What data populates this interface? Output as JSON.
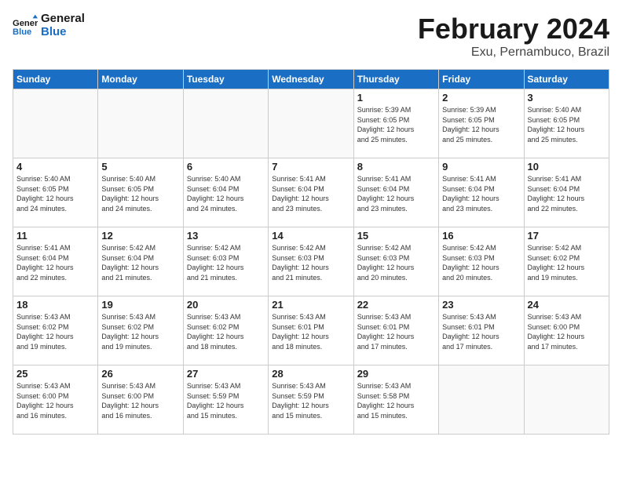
{
  "header": {
    "logo_general": "General",
    "logo_blue": "Blue",
    "month": "February 2024",
    "location": "Exu, Pernambuco, Brazil"
  },
  "weekdays": [
    "Sunday",
    "Monday",
    "Tuesday",
    "Wednesday",
    "Thursday",
    "Friday",
    "Saturday"
  ],
  "weeks": [
    [
      {
        "day": "",
        "info": ""
      },
      {
        "day": "",
        "info": ""
      },
      {
        "day": "",
        "info": ""
      },
      {
        "day": "",
        "info": ""
      },
      {
        "day": "1",
        "info": "Sunrise: 5:39 AM\nSunset: 6:05 PM\nDaylight: 12 hours\nand 25 minutes."
      },
      {
        "day": "2",
        "info": "Sunrise: 5:39 AM\nSunset: 6:05 PM\nDaylight: 12 hours\nand 25 minutes."
      },
      {
        "day": "3",
        "info": "Sunrise: 5:40 AM\nSunset: 6:05 PM\nDaylight: 12 hours\nand 25 minutes."
      }
    ],
    [
      {
        "day": "4",
        "info": "Sunrise: 5:40 AM\nSunset: 6:05 PM\nDaylight: 12 hours\nand 24 minutes."
      },
      {
        "day": "5",
        "info": "Sunrise: 5:40 AM\nSunset: 6:05 PM\nDaylight: 12 hours\nand 24 minutes."
      },
      {
        "day": "6",
        "info": "Sunrise: 5:40 AM\nSunset: 6:04 PM\nDaylight: 12 hours\nand 24 minutes."
      },
      {
        "day": "7",
        "info": "Sunrise: 5:41 AM\nSunset: 6:04 PM\nDaylight: 12 hours\nand 23 minutes."
      },
      {
        "day": "8",
        "info": "Sunrise: 5:41 AM\nSunset: 6:04 PM\nDaylight: 12 hours\nand 23 minutes."
      },
      {
        "day": "9",
        "info": "Sunrise: 5:41 AM\nSunset: 6:04 PM\nDaylight: 12 hours\nand 23 minutes."
      },
      {
        "day": "10",
        "info": "Sunrise: 5:41 AM\nSunset: 6:04 PM\nDaylight: 12 hours\nand 22 minutes."
      }
    ],
    [
      {
        "day": "11",
        "info": "Sunrise: 5:41 AM\nSunset: 6:04 PM\nDaylight: 12 hours\nand 22 minutes."
      },
      {
        "day": "12",
        "info": "Sunrise: 5:42 AM\nSunset: 6:04 PM\nDaylight: 12 hours\nand 21 minutes."
      },
      {
        "day": "13",
        "info": "Sunrise: 5:42 AM\nSunset: 6:03 PM\nDaylight: 12 hours\nand 21 minutes."
      },
      {
        "day": "14",
        "info": "Sunrise: 5:42 AM\nSunset: 6:03 PM\nDaylight: 12 hours\nand 21 minutes."
      },
      {
        "day": "15",
        "info": "Sunrise: 5:42 AM\nSunset: 6:03 PM\nDaylight: 12 hours\nand 20 minutes."
      },
      {
        "day": "16",
        "info": "Sunrise: 5:42 AM\nSunset: 6:03 PM\nDaylight: 12 hours\nand 20 minutes."
      },
      {
        "day": "17",
        "info": "Sunrise: 5:42 AM\nSunset: 6:02 PM\nDaylight: 12 hours\nand 19 minutes."
      }
    ],
    [
      {
        "day": "18",
        "info": "Sunrise: 5:43 AM\nSunset: 6:02 PM\nDaylight: 12 hours\nand 19 minutes."
      },
      {
        "day": "19",
        "info": "Sunrise: 5:43 AM\nSunset: 6:02 PM\nDaylight: 12 hours\nand 19 minutes."
      },
      {
        "day": "20",
        "info": "Sunrise: 5:43 AM\nSunset: 6:02 PM\nDaylight: 12 hours\nand 18 minutes."
      },
      {
        "day": "21",
        "info": "Sunrise: 5:43 AM\nSunset: 6:01 PM\nDaylight: 12 hours\nand 18 minutes."
      },
      {
        "day": "22",
        "info": "Sunrise: 5:43 AM\nSunset: 6:01 PM\nDaylight: 12 hours\nand 17 minutes."
      },
      {
        "day": "23",
        "info": "Sunrise: 5:43 AM\nSunset: 6:01 PM\nDaylight: 12 hours\nand 17 minutes."
      },
      {
        "day": "24",
        "info": "Sunrise: 5:43 AM\nSunset: 6:00 PM\nDaylight: 12 hours\nand 17 minutes."
      }
    ],
    [
      {
        "day": "25",
        "info": "Sunrise: 5:43 AM\nSunset: 6:00 PM\nDaylight: 12 hours\nand 16 minutes."
      },
      {
        "day": "26",
        "info": "Sunrise: 5:43 AM\nSunset: 6:00 PM\nDaylight: 12 hours\nand 16 minutes."
      },
      {
        "day": "27",
        "info": "Sunrise: 5:43 AM\nSunset: 5:59 PM\nDaylight: 12 hours\nand 15 minutes."
      },
      {
        "day": "28",
        "info": "Sunrise: 5:43 AM\nSunset: 5:59 PM\nDaylight: 12 hours\nand 15 minutes."
      },
      {
        "day": "29",
        "info": "Sunrise: 5:43 AM\nSunset: 5:58 PM\nDaylight: 12 hours\nand 15 minutes."
      },
      {
        "day": "",
        "info": ""
      },
      {
        "day": "",
        "info": ""
      }
    ]
  ]
}
